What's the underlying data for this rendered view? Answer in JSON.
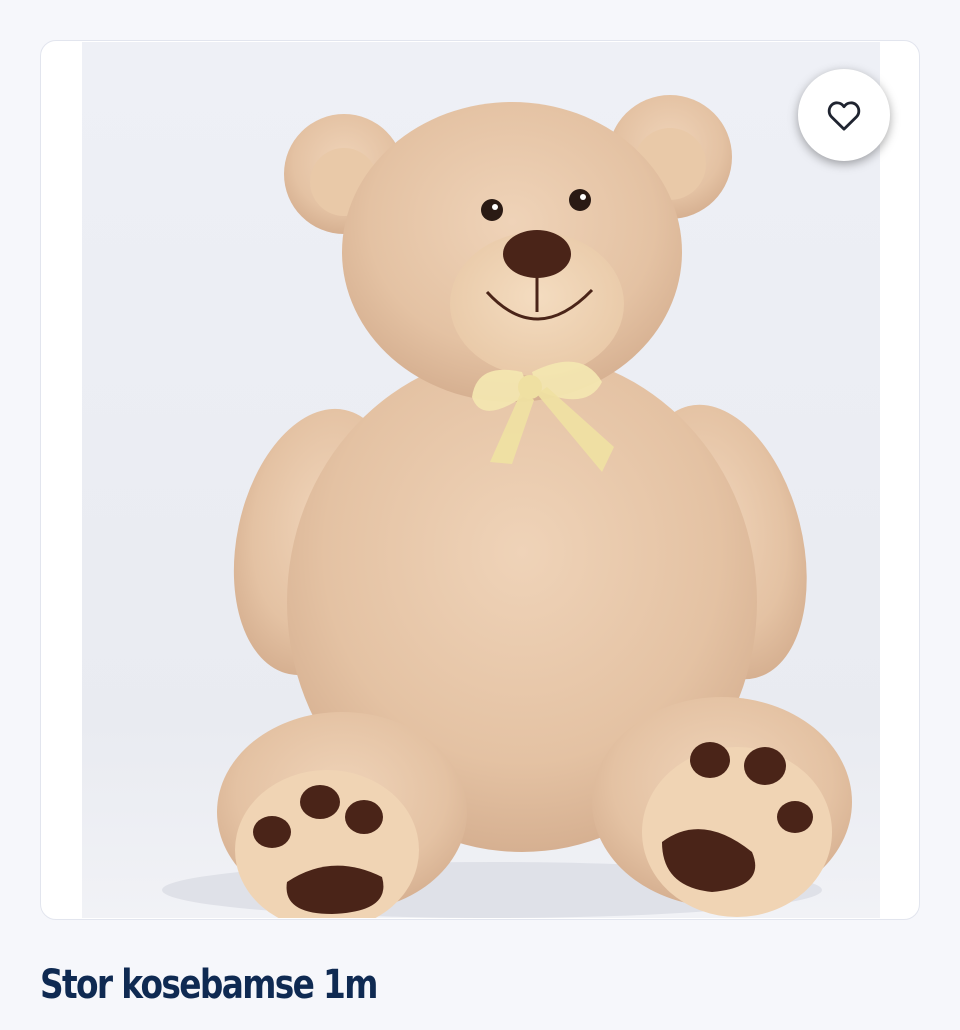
{
  "product": {
    "title": "Stor kosebamse 1m",
    "image_subject": "teddy-bear",
    "favorite_icon": "heart-outline-icon"
  },
  "colors": {
    "page_background": "#f6f7fb",
    "card_border": "#e2e5ee",
    "title_text": "#0f2a52",
    "bear_fur": "#e8c8aa",
    "paw_pads": "#4a2418",
    "ribbon": "#f3e6b0"
  }
}
